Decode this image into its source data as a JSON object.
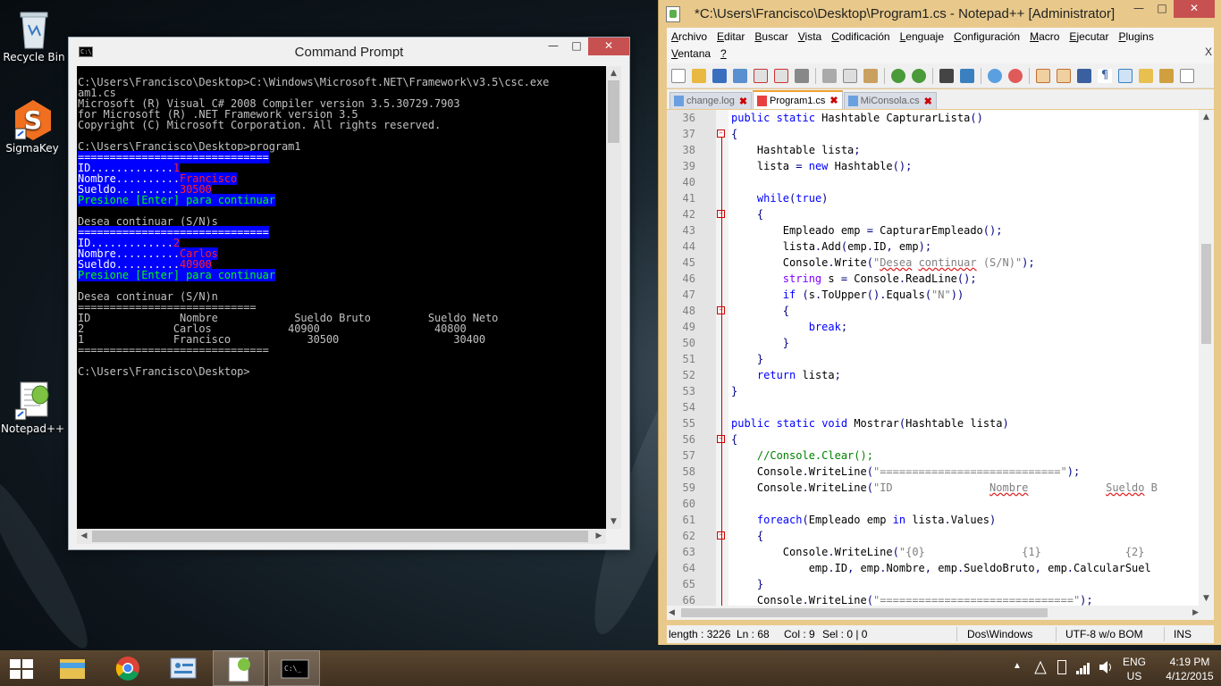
{
  "desktop": {
    "icons": [
      {
        "label": "Recycle Bin",
        "icon": "recycle-bin-icon"
      },
      {
        "label": "SigmaKey",
        "icon": "sigmakey-icon"
      },
      {
        "label": "Notepad++",
        "icon": "notepad-plus-plus-icon"
      }
    ]
  },
  "cmd": {
    "title": "Command Prompt",
    "icon": "cmd-icon",
    "lines": [
      {
        "t": "C:\\Users\\Francisco\\Desktop>C:\\Windows\\Microsoft.NET\\Framework\\v3.5\\csc.exe"
      },
      {
        "t": "am1.cs"
      },
      {
        "t": "Microsoft (R) Visual C# 2008 Compiler version 3.5.30729.7903"
      },
      {
        "t": "for Microsoft (R) .NET Framework version 3.5"
      },
      {
        "t": "Copyright (C) Microsoft Corporation. All rights reserved."
      },
      {
        "t": ""
      },
      {
        "t": "C:\\Users\\Francisco\\Desktop>program1"
      },
      {
        "t": "==============================",
        "style": "wb"
      },
      {
        "parts": [
          {
            "t": "ID.............",
            "style": "wb"
          },
          {
            "t": "1",
            "style": "rd"
          }
        ]
      },
      {
        "parts": [
          {
            "t": "Nombre..........",
            "style": "wb"
          },
          {
            "t": "Francisco",
            "style": "rd"
          }
        ]
      },
      {
        "parts": [
          {
            "t": "Sueldo..........",
            "style": "wb"
          },
          {
            "t": "30500",
            "style": "rd"
          }
        ]
      },
      {
        "t": "Presione [Enter] para continuar",
        "style": "gr"
      },
      {
        "t": ""
      },
      {
        "t": "Desea continuar (S/N)s"
      },
      {
        "t": "==============================",
        "style": "wb"
      },
      {
        "parts": [
          {
            "t": "ID.............",
            "style": "wb"
          },
          {
            "t": "2",
            "style": "rd"
          }
        ]
      },
      {
        "parts": [
          {
            "t": "Nombre..........",
            "style": "wb"
          },
          {
            "t": "Carlos",
            "style": "rd"
          }
        ]
      },
      {
        "parts": [
          {
            "t": "Sueldo..........",
            "style": "wb"
          },
          {
            "t": "40900",
            "style": "rd"
          }
        ]
      },
      {
        "t": "Presione [Enter] para continuar",
        "style": "gr"
      },
      {
        "t": ""
      },
      {
        "t": "Desea continuar (S/N)n"
      },
      {
        "t": "============================"
      },
      {
        "t": "ID              Nombre            Sueldo Bruto         Sueldo Neto"
      },
      {
        "t": "2              Carlos            40900                  40800"
      },
      {
        "t": "1              Francisco            30500                  30400"
      },
      {
        "t": "=============================="
      },
      {
        "t": ""
      },
      {
        "t": "C:\\Users\\Francisco\\Desktop>"
      }
    ]
  },
  "npp": {
    "title": "*C:\\Users\\Francisco\\Desktop\\Program1.cs - Notepad++ [Administrator]",
    "menu_row1": [
      "Archivo",
      "Editar",
      "Buscar",
      "Vista",
      "Codificación",
      "Lenguaje",
      "Configuración",
      "Macro",
      "Ejecutar",
      "Plugins"
    ],
    "menu_row2": [
      "Ventana",
      "?"
    ],
    "close_doc": "X",
    "tabs": [
      {
        "label": "change.log",
        "active": false
      },
      {
        "label": "Program1.cs",
        "active": true
      },
      {
        "label": "MiConsola.cs",
        "active": false
      }
    ],
    "code": [
      {
        "n": "36",
        "html": "<span class=\"kw\">public</span> <span class=\"kw\">static</span> Hashtable CapturarLista<span class=\"op\">()</span>",
        "fold": false
      },
      {
        "n": "37",
        "html": "<span class=\"op\">{</span>",
        "fold": true
      },
      {
        "n": "38",
        "html": "    Hashtable lista<span class=\"op\">;</span>",
        "fold": false
      },
      {
        "n": "39",
        "html": "    lista <span class=\"op\">=</span> <span class=\"kw\">new</span> Hashtable<span class=\"op\">();</span>",
        "fold": false
      },
      {
        "n": "40",
        "html": "",
        "fold": false
      },
      {
        "n": "41",
        "html": "    <span class=\"kw\">while</span><span class=\"op\">(</span><span class=\"kw\">true</span><span class=\"op\">)</span>",
        "fold": false
      },
      {
        "n": "42",
        "html": "    <span class=\"op\">{</span>",
        "fold": true
      },
      {
        "n": "43",
        "html": "        Empleado emp <span class=\"op\">=</span> CapturarEmpleado<span class=\"op\">();</span>",
        "fold": false
      },
      {
        "n": "44",
        "html": "        lista<span class=\"op\">.</span>Add<span class=\"op\">(</span>emp<span class=\"op\">.</span>ID<span class=\"op\">,</span> emp<span class=\"op\">);</span>",
        "fold": false
      },
      {
        "n": "45",
        "html": "        Console<span class=\"op\">.</span>Write<span class=\"op\">(</span><span class=\"st\">\"<span class=\"ul\">Desea</span> <span class=\"ul\">continuar</span> (S/N)\"</span><span class=\"op\">);</span>",
        "fold": false
      },
      {
        "n": "46",
        "html": "        <span class=\"ty\">string</span> s <span class=\"op\">=</span> Console<span class=\"op\">.</span>ReadLine<span class=\"op\">();</span>",
        "fold": false
      },
      {
        "n": "47",
        "html": "        <span class=\"kw\">if</span> <span class=\"op\">(</span>s<span class=\"op\">.</span>ToUpper<span class=\"op\">().</span>Equals<span class=\"op\">(</span><span class=\"st\">\"N\"</span><span class=\"op\">))</span>",
        "fold": false
      },
      {
        "n": "48",
        "html": "        <span class=\"op\">{</span>",
        "fold": true
      },
      {
        "n": "49",
        "html": "            <span class=\"kw\">break</span><span class=\"op\">;</span>",
        "fold": false
      },
      {
        "n": "50",
        "html": "        <span class=\"op\">}</span>",
        "fold": false
      },
      {
        "n": "51",
        "html": "    <span class=\"op\">}</span>",
        "fold": false
      },
      {
        "n": "52",
        "html": "    <span class=\"kw\">return</span> lista<span class=\"op\">;</span>",
        "fold": false
      },
      {
        "n": "53",
        "html": "<span class=\"op\">}</span>",
        "fold": false
      },
      {
        "n": "54",
        "html": "",
        "fold": false
      },
      {
        "n": "55",
        "html": "<span class=\"kw\">public</span> <span class=\"kw\">static</span> <span class=\"kw\">void</span> Mostrar<span class=\"op\">(</span>Hashtable lista<span class=\"op\">)</span>",
        "fold": false
      },
      {
        "n": "56",
        "html": "<span class=\"op\">{</span>",
        "fold": true
      },
      {
        "n": "57",
        "html": "    <span class=\"cm\">//Console.Clear();</span>",
        "fold": false
      },
      {
        "n": "58",
        "html": "    Console<span class=\"op\">.</span>WriteLine<span class=\"op\">(</span><span class=\"st\">\"============================\"</span><span class=\"op\">);</span>",
        "fold": false
      },
      {
        "n": "59",
        "html": "    Console<span class=\"op\">.</span>WriteLine<span class=\"op\">(</span><span class=\"st\">\"ID               <span class=\"ul\">Nombre</span>            <span class=\"ul\">Sueldo</span> B</span>",
        "fold": false
      },
      {
        "n": "60",
        "html": "",
        "fold": false
      },
      {
        "n": "61",
        "html": "    <span class=\"kw\">foreach</span><span class=\"op\">(</span>Empleado emp <span class=\"kw\">in</span> lista<span class=\"op\">.</span>Values<span class=\"op\">)</span>",
        "fold": false
      },
      {
        "n": "62",
        "html": "    <span class=\"op\">{</span>",
        "fold": true
      },
      {
        "n": "63",
        "html": "        Console<span class=\"op\">.</span>WriteLine<span class=\"op\">(</span><span class=\"st\">\"{0}               {1}             {2}</span>",
        "fold": false
      },
      {
        "n": "64",
        "html": "            emp<span class=\"op\">.</span>ID<span class=\"op\">,</span> emp<span class=\"op\">.</span>Nombre<span class=\"op\">,</span> emp<span class=\"op\">.</span>SueldoBruto<span class=\"op\">,</span> emp<span class=\"op\">.</span>CalcularSuel",
        "fold": false
      },
      {
        "n": "65",
        "html": "    <span class=\"op\">}</span>",
        "fold": false
      },
      {
        "n": "66",
        "html": "    Console<span class=\"op\">.</span>WriteLine<span class=\"op\">(</span><span class=\"st\">\"==============================\"</span><span class=\"op\">);</span>",
        "fold": false
      }
    ],
    "status": {
      "length": "length : 3226",
      "ln": "Ln : 68",
      "col": "Col : 9",
      "sel": "Sel : 0 | 0",
      "eol": "Dos\\Windows",
      "encoding": "UTF-8 w/o BOM",
      "mode": "INS"
    }
  },
  "taskbar": {
    "apps": [
      {
        "icon": "file-explorer-icon"
      },
      {
        "icon": "chrome-icon"
      },
      {
        "icon": "control-panel-icon"
      },
      {
        "icon": "notepad-plus-plus-icon",
        "active": true
      },
      {
        "icon": "cmd-icon",
        "active": true
      }
    ],
    "lang_top": "ENG",
    "lang_bottom": "US",
    "time": "4:19 PM",
    "date": "4/12/2015"
  },
  "colors": {
    "npp_frame": "#e8c98b",
    "console_bg": "#000000",
    "console_highlight": "#0000ff",
    "console_green": "#00ff00",
    "console_red": "#ff2020"
  }
}
